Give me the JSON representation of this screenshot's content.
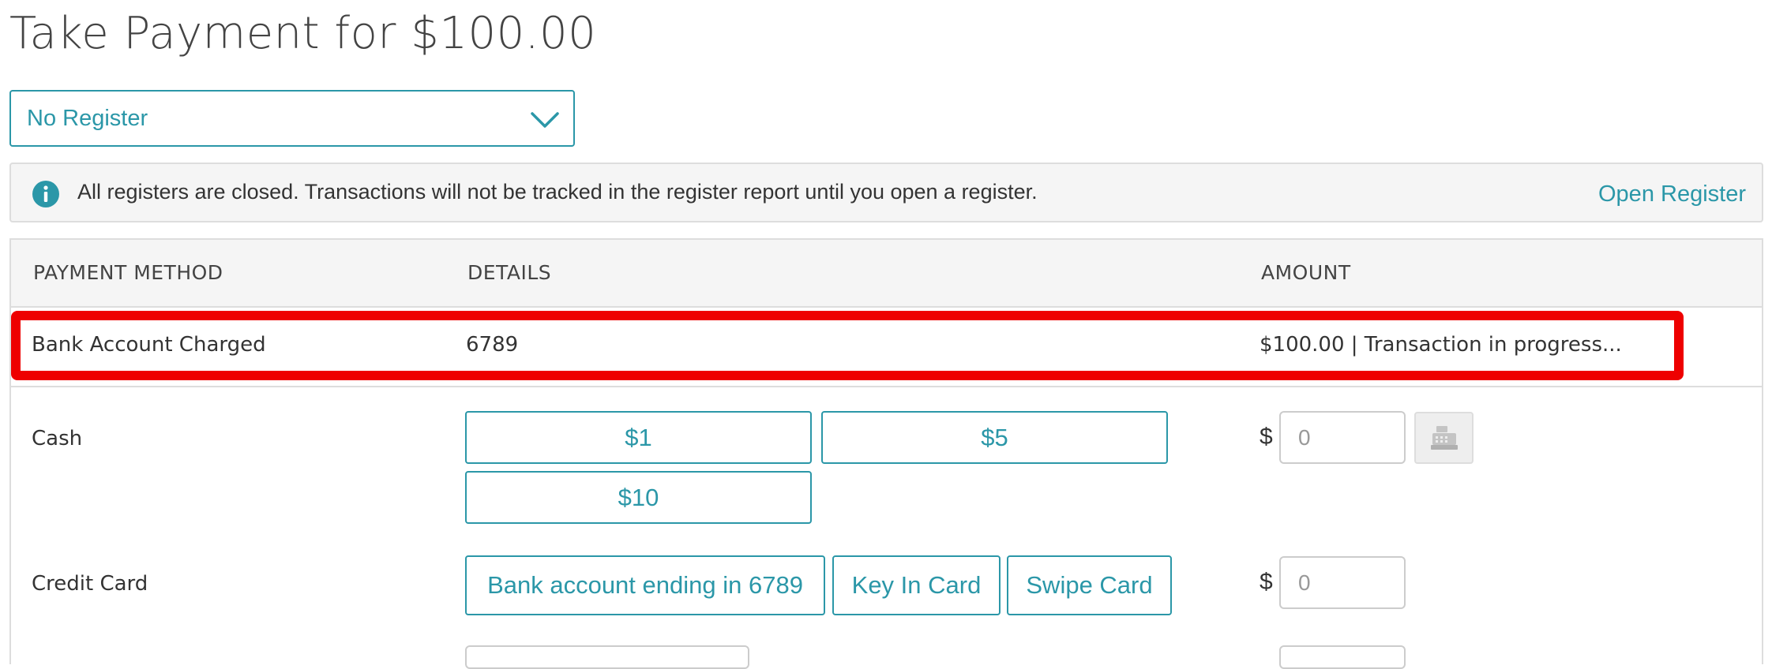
{
  "header": {
    "title": "Take Payment for $100.00"
  },
  "register_select": {
    "value": "No Register"
  },
  "info_banner": {
    "message": "All registers are closed. Transactions will not be tracked in the register report until you open a register.",
    "link_label": "Open Register"
  },
  "table": {
    "columns": [
      "PAYMENT METHOD",
      "DETAILS",
      "AMOUNT"
    ],
    "charged_row": {
      "method": "Bank Account Charged",
      "details": "6789",
      "amount": "$100.00 | Transaction in progress..."
    },
    "cash_row": {
      "method": "Cash",
      "quick_amounts": [
        "$1",
        "$5",
        "$10"
      ],
      "currency": "$",
      "amount_placeholder": "0"
    },
    "credit_row": {
      "method": "Credit Card",
      "options": [
        "Bank account ending in 6789",
        "Key In Card",
        "Swipe Card"
      ],
      "currency": "$",
      "amount_placeholder": "0"
    }
  },
  "colors": {
    "accent": "#2b97a8",
    "highlight": "#ee0000",
    "banner_bg": "#f5f5f5",
    "border": "#dddddd"
  },
  "icons": [
    "chevron-down-icon",
    "info-icon",
    "cash-register-icon"
  ]
}
